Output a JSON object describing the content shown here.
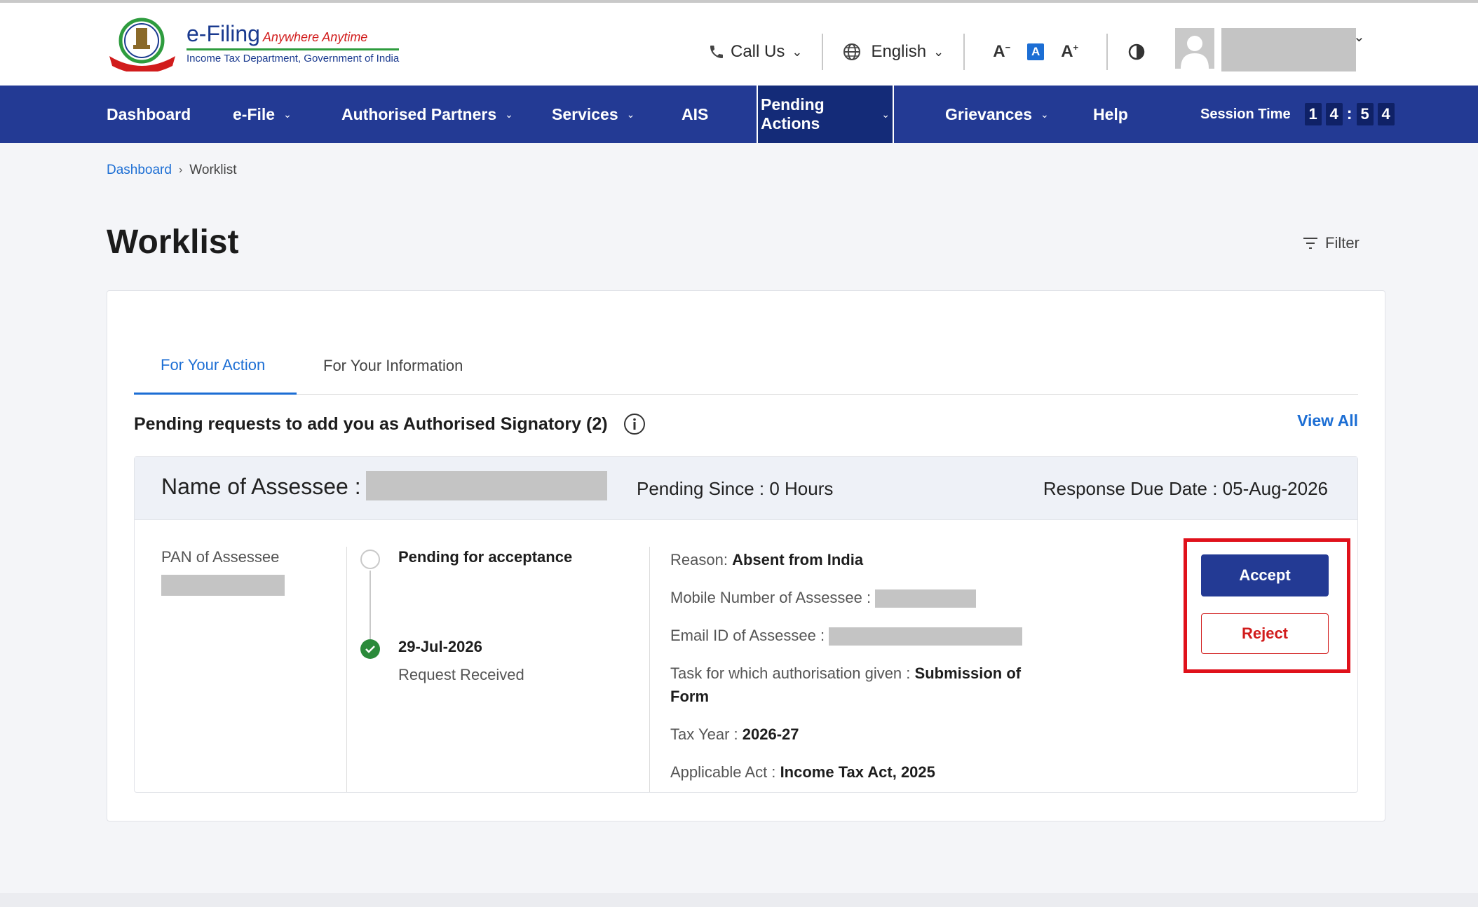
{
  "header": {
    "logo_title": "e-Filing",
    "logo_tagline": "Anywhere Anytime",
    "logo_subtitle": "Income Tax Department, Government of India",
    "call_us": "Call Us",
    "language": "English",
    "font_decrease": "A",
    "font_normal": "A",
    "font_increase": "A",
    "icons": [
      "emblem-logo",
      "phone-icon",
      "globe-icon",
      "contrast-icon",
      "avatar"
    ]
  },
  "nav": {
    "items": [
      {
        "label": "Dashboard",
        "dropdown": false
      },
      {
        "label": "e-File",
        "dropdown": true
      },
      {
        "label": "Authorised Partners",
        "dropdown": true
      },
      {
        "label": "Services",
        "dropdown": true
      },
      {
        "label": "AIS",
        "dropdown": false
      },
      {
        "label": "Pending Actions",
        "dropdown": true,
        "active": true
      },
      {
        "label": "Grievances",
        "dropdown": true
      },
      {
        "label": "Help",
        "dropdown": false
      }
    ],
    "session_label": "Session Time",
    "session_digits": [
      "1",
      "4",
      "5",
      "4"
    ]
  },
  "breadcrumb": {
    "root": "Dashboard",
    "current": "Worklist"
  },
  "page": {
    "title": "Worklist",
    "filter_label": "Filter"
  },
  "tabs": [
    {
      "label": "For Your Action",
      "active": true
    },
    {
      "label": "For Your Information",
      "active": false
    }
  ],
  "section": {
    "title": "Pending requests to add you as Authorised Signatory (2)",
    "view_all": "View All"
  },
  "request": {
    "name_label": "Name of Assessee :",
    "pending_since": "Pending Since : 0 Hours",
    "response_due": "Response Due Date : 05-Aug-2026",
    "pan_label": "PAN of Assessee",
    "status_pending": "Pending for acceptance",
    "received_date": "29-Jul-2026",
    "received_label": "Request Received",
    "reason_label": "Reason:",
    "reason_value": "Absent from India",
    "mobile_label": "Mobile Number of Assessee :",
    "email_label": "Email ID of Assessee :",
    "task_label": "Task for which authorisation given :",
    "task_value": "Submission of Form",
    "tax_year_label": "Tax Year :",
    "tax_year_value": "2026-27",
    "act_label": "Applicable Act :",
    "act_value": "Income Tax Act, 2025",
    "accept_label": "Accept",
    "reject_label": "Reject"
  },
  "colors": {
    "nav_bg": "#233a94",
    "accent_blue": "#1c6ed4",
    "reject_red": "#d11c1c",
    "highlight_red": "#e0111b",
    "success_green": "#2a8a3a"
  }
}
